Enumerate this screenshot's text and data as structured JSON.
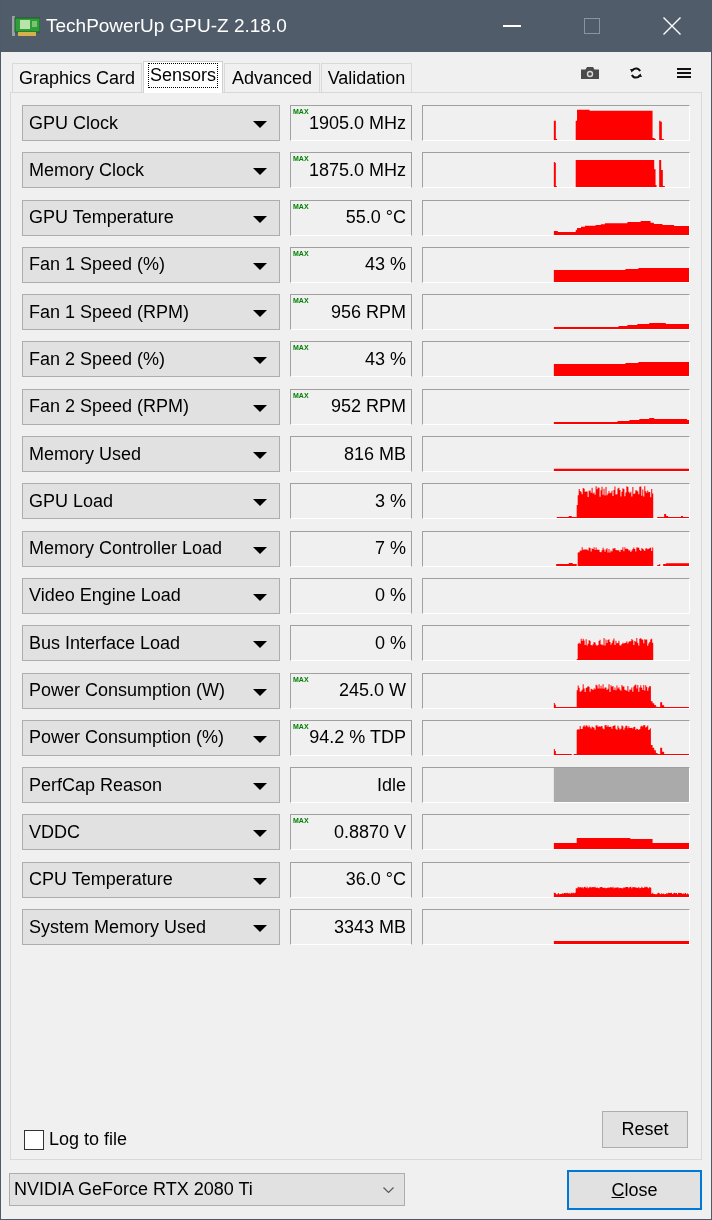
{
  "window": {
    "title": "TechPowerUp GPU-Z 2.18.0",
    "controls": [
      {
        "kind": "minimize",
        "disabled": false
      },
      {
        "kind": "maximize",
        "disabled": true
      },
      {
        "kind": "close",
        "disabled": false
      }
    ]
  },
  "tabs": [
    {
      "label": "Graphics Card",
      "selected": false
    },
    {
      "label": "Sensors",
      "selected": true
    },
    {
      "label": "Advanced",
      "selected": false
    },
    {
      "label": "Validation",
      "selected": false
    }
  ],
  "toolbar": [
    {
      "kind": "camera"
    },
    {
      "kind": "refresh"
    },
    {
      "kind": "menu"
    }
  ],
  "sensors": [
    {
      "name": "GPU Clock",
      "value": "1905.0 MHz",
      "badge": "MAX",
      "color": "#ff0000"
    },
    {
      "name": "Memory Clock",
      "value": "1875.0 MHz",
      "badge": "MAX",
      "color": "#ff0000"
    },
    {
      "name": "GPU Temperature",
      "value": "55.0 °C",
      "badge": "MAX",
      "color": "#ff0000"
    },
    {
      "name": "Fan 1 Speed (%)",
      "value": "43 %",
      "badge": "MAX",
      "color": "#ff0000"
    },
    {
      "name": "Fan 1 Speed (RPM)",
      "value": "956 RPM",
      "badge": "MAX",
      "color": "#ff0000"
    },
    {
      "name": "Fan 2 Speed (%)",
      "value": "43 %",
      "badge": "MAX",
      "color": "#ff0000"
    },
    {
      "name": "Fan 2 Speed (RPM)",
      "value": "952 RPM",
      "badge": "MAX",
      "color": "#ff0000"
    },
    {
      "name": "Memory Used",
      "value": "816 MB",
      "color": "#ff0000"
    },
    {
      "name": "GPU Load",
      "value": "3 %",
      "color": "#ff0000"
    },
    {
      "name": "Memory Controller Load",
      "value": "7 %",
      "color": "#ff0000"
    },
    {
      "name": "Video Engine Load",
      "value": "0 %"
    },
    {
      "name": "Bus Interface Load",
      "value": "0 %",
      "color": "#ff0000"
    },
    {
      "name": "Power Consumption (W)",
      "value": "245.0 W",
      "badge": "MAX",
      "color": "#ff0000"
    },
    {
      "name": "Power Consumption (%)",
      "value": "94.2 % TDP",
      "badge": "MAX",
      "color": "#ff0000"
    },
    {
      "name": "PerfCap Reason",
      "value": "Idle",
      "color": "#aaaaaa"
    },
    {
      "name": "VDDC",
      "value": "0.8870 V",
      "badge": "MAX",
      "color": "#ff0000"
    },
    {
      "name": "CPU Temperature",
      "value": "36.0 °C",
      "color": "#ff0000"
    },
    {
      "name": "System Memory Used",
      "value": "3343 MB",
      "color": "#ff0000"
    }
  ],
  "log_to_file": {
    "label": "Log to file",
    "checked": false
  },
  "reset_button": "Reset",
  "gpu_select": {
    "value": "NVIDIA GeForce RTX 2080 Ti"
  },
  "close_button": "Close"
}
